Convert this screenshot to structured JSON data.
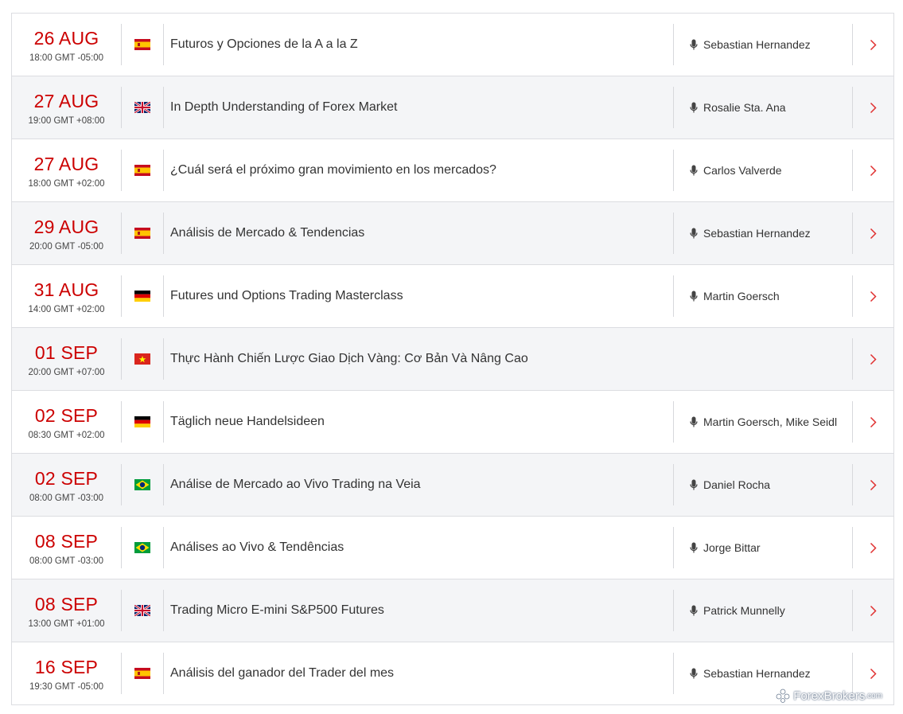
{
  "events": [
    {
      "day": "26 AUG",
      "time": "18:00 GMT -05:00",
      "flag": "spain-flag-icon",
      "title": "Futuros y Opciones de la A a la Z",
      "speaker": "Sebastian Hernandez"
    },
    {
      "day": "27 AUG",
      "time": "19:00 GMT +08:00",
      "flag": "uk-flag-icon",
      "title": "In Depth Understanding of Forex Market",
      "speaker": "Rosalie Sta. Ana"
    },
    {
      "day": "27 AUG",
      "time": "18:00 GMT +02:00",
      "flag": "spain-flag-icon",
      "title": "¿Cuál será el próximo gran movimiento en los mercados?",
      "speaker": "Carlos Valverde"
    },
    {
      "day": "29 AUG",
      "time": "20:00 GMT -05:00",
      "flag": "spain-flag-icon",
      "title": "Análisis de Mercado & Tendencias",
      "speaker": "Sebastian Hernandez"
    },
    {
      "day": "31 AUG",
      "time": "14:00 GMT +02:00",
      "flag": "germany-flag-icon",
      "title": "Futures und Options Trading Masterclass",
      "speaker": "Martin Goersch"
    },
    {
      "day": "01 SEP",
      "time": "20:00 GMT +07:00",
      "flag": "vietnam-flag-icon",
      "title": "Thực Hành Chiến Lược Giao Dịch Vàng: Cơ Bản Và Nâng Cao",
      "speaker": ""
    },
    {
      "day": "02 SEP",
      "time": "08:30 GMT +02:00",
      "flag": "germany-flag-icon",
      "title": "Täglich neue Handelsideen",
      "speaker": "Martin Goersch, Mike Seidl"
    },
    {
      "day": "02 SEP",
      "time": "08:00 GMT -03:00",
      "flag": "brazil-flag-icon",
      "title": "Análise de Mercado ao Vivo Trading na Veia",
      "speaker": "Daniel Rocha"
    },
    {
      "day": "08 SEP",
      "time": "08:00 GMT -03:00",
      "flag": "brazil-flag-icon",
      "title": "Análises ao Vivo & Tendências",
      "speaker": "Jorge Bittar"
    },
    {
      "day": "08 SEP",
      "time": "13:00 GMT +01:00",
      "flag": "uk-flag-icon",
      "title": "Trading Micro E-mini S&P500 Futures",
      "speaker": "Patrick Munnelly"
    },
    {
      "day": "16 SEP",
      "time": "19:30 GMT -05:00",
      "flag": "spain-flag-icon",
      "title": "Análisis del ganador del Trader del mes",
      "speaker": "Sebastian Hernandez"
    }
  ],
  "colors": {
    "date_accent": "#cc0000",
    "row_alt_bg": "#f4f5f7",
    "border": "#dcdde1",
    "chevron": "#e03030"
  },
  "watermark": {
    "brand": "ForexBrokers",
    "suffix": ".com"
  }
}
